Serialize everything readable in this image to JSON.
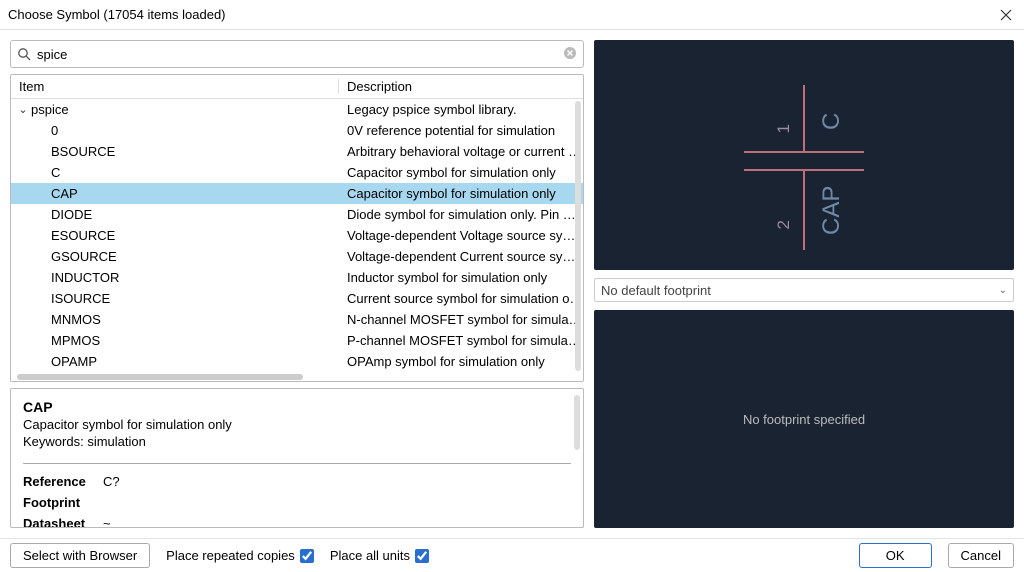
{
  "window": {
    "title": "Choose Symbol (17054 items loaded)"
  },
  "search": {
    "value": "spice"
  },
  "columns": {
    "item": "Item",
    "description": "Description"
  },
  "library": {
    "name": "pspice",
    "description": "Legacy pspice symbol library.",
    "expanded": true
  },
  "items": [
    {
      "name": "0",
      "desc": "0V reference potential for simulation",
      "selected": false
    },
    {
      "name": "BSOURCE",
      "desc": "Arbitrary behavioral voltage or current sou",
      "selected": false
    },
    {
      "name": "C",
      "desc": "Capacitor symbol for simulation only",
      "selected": false
    },
    {
      "name": "CAP",
      "desc": "Capacitor symbol for simulation only",
      "selected": true
    },
    {
      "name": "DIODE",
      "desc": "Diode symbol for simulation only. Pin orde",
      "selected": false
    },
    {
      "name": "ESOURCE",
      "desc": "Voltage-dependent Voltage source symbo",
      "selected": false
    },
    {
      "name": "GSOURCE",
      "desc": "Voltage-dependent Current source symbo",
      "selected": false
    },
    {
      "name": "INDUCTOR",
      "desc": "Inductor symbol for simulation only",
      "selected": false
    },
    {
      "name": "ISOURCE",
      "desc": "Current source symbol for simulation only",
      "selected": false
    },
    {
      "name": "MNMOS",
      "desc": "N-channel MOSFET symbol for simulation",
      "selected": false
    },
    {
      "name": "MPMOS",
      "desc": "P-channel MOSFET symbol for simulation o",
      "selected": false
    },
    {
      "name": "OPAMP",
      "desc": "OPAmp symbol for simulation only",
      "selected": false
    }
  ],
  "detail": {
    "name": "CAP",
    "desc": "Capacitor symbol for simulation only",
    "keywords_label": "Keywords:",
    "keywords": "simulation",
    "fields": {
      "reference_label": "Reference",
      "reference_value": "C?",
      "footprint_label": "Footprint",
      "footprint_value": "",
      "datasheet_label": "Datasheet",
      "datasheet_value": "~"
    }
  },
  "preview": {
    "pin1": "1",
    "pin2": "2",
    "ref": "C",
    "val": "CAP"
  },
  "footprint": {
    "select_text": "No default footprint",
    "preview_text": "No footprint specified"
  },
  "bottom": {
    "select_browser": "Select with Browser",
    "repeated_label": "Place repeated copies",
    "repeated_checked": true,
    "allunits_label": "Place all units",
    "allunits_checked": true,
    "ok": "OK",
    "cancel": "Cancel"
  }
}
